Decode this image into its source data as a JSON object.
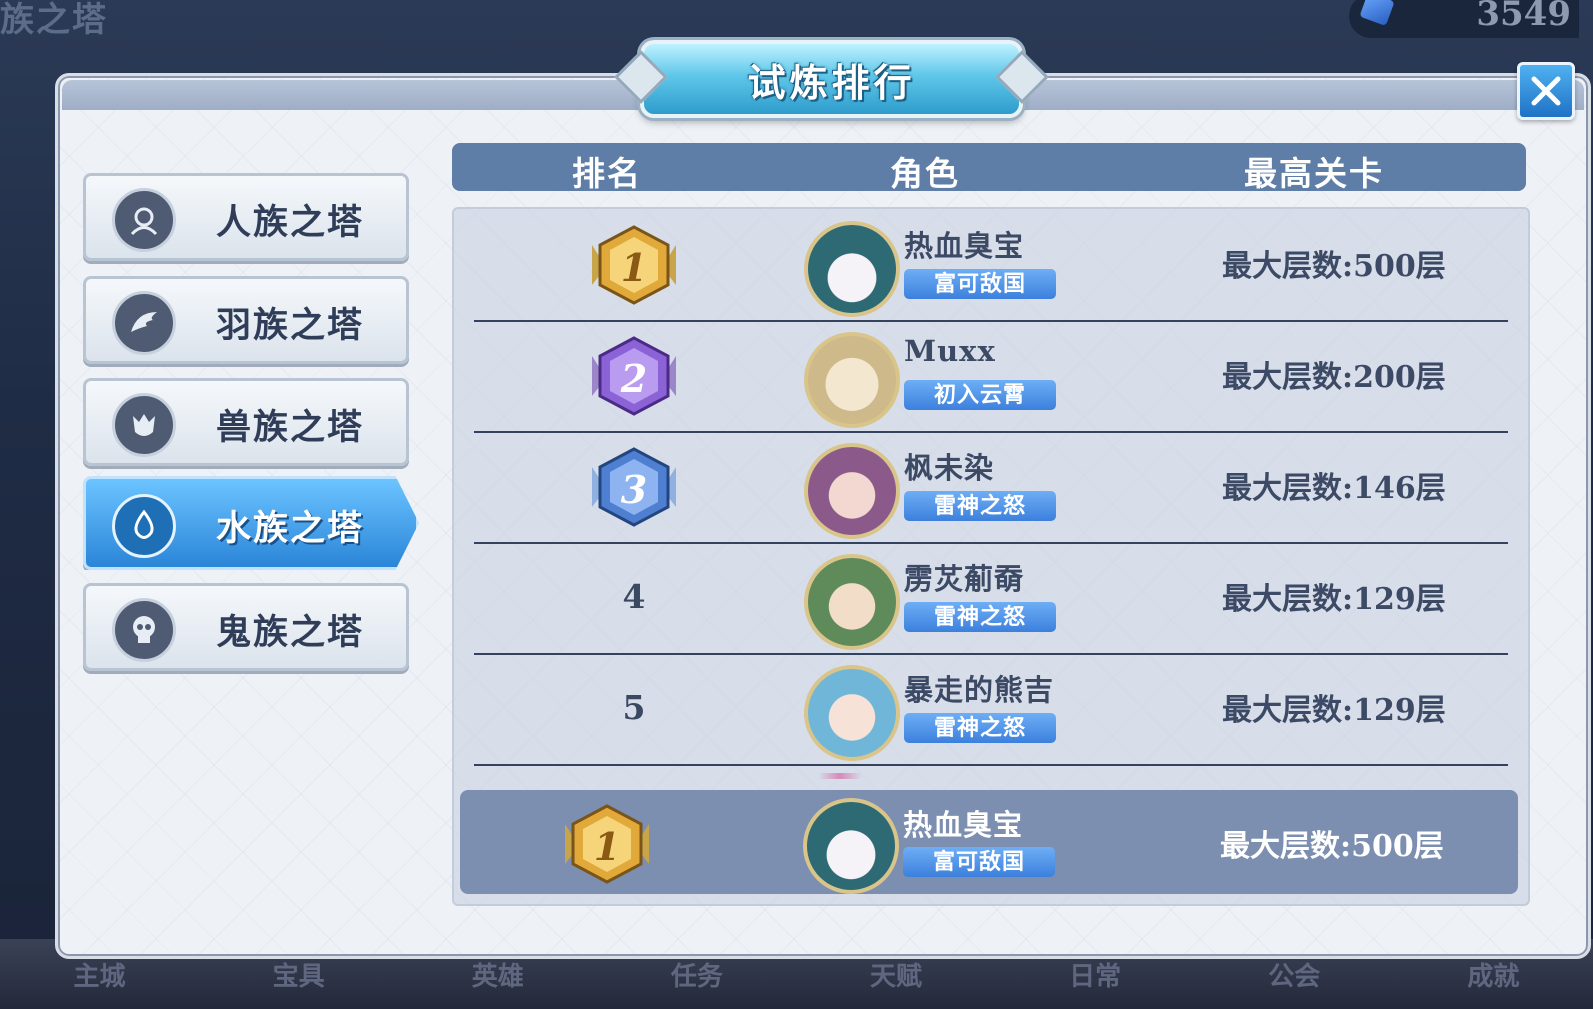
{
  "background": {
    "title": "族之塔",
    "currency_value": "3549",
    "nav_items": [
      "主城",
      "宝具",
      "英雄",
      "任务",
      "天赋",
      "日常",
      "公会",
      "成就"
    ]
  },
  "panel": {
    "title": "试炼排行"
  },
  "tabs": [
    {
      "label": "人族之塔",
      "icon": "human-emblem-icon",
      "active": false
    },
    {
      "label": "羽族之塔",
      "icon": "wing-emblem-icon",
      "active": false
    },
    {
      "label": "兽族之塔",
      "icon": "beast-emblem-icon",
      "active": false
    },
    {
      "label": "水族之塔",
      "icon": "water-emblem-icon",
      "active": true
    },
    {
      "label": "鬼族之塔",
      "icon": "skull-emblem-icon",
      "active": false
    }
  ],
  "table": {
    "headers": {
      "rank": "排名",
      "role": "角色",
      "max_stage": "最高关卡"
    },
    "rows": [
      {
        "rank": "1",
        "name": "热血臭宝",
        "title": "富可敌国",
        "max_floor": "最大层数:500层",
        "badge_color": "#e0a93a"
      },
      {
        "rank": "2",
        "name": "Muxx",
        "title": "初入云霄",
        "max_floor": "最大层数:200层",
        "badge_color": "#8c63d6"
      },
      {
        "rank": "3",
        "name": "枫未染",
        "title": "雷神之怒",
        "max_floor": "最大层数:146层",
        "badge_color": "#4f7fd0"
      },
      {
        "rank": "4",
        "name": "雳炗葪奣",
        "title": "雷神之怒",
        "max_floor": "最大层数:129层"
      },
      {
        "rank": "5",
        "name": "暴走的熊吉",
        "title": "雷神之怒",
        "max_floor": "最大层数:129层"
      }
    ],
    "my_rank": {
      "rank": "1",
      "name": "热血臭宝",
      "title": "富可敌国",
      "max_floor": "最大层数:500层",
      "badge_color": "#e0a93a"
    }
  },
  "colors": {
    "accent_blue": "#2a85d8",
    "header_bg": "#5e7da7",
    "title_chip": "#3c80dd",
    "my_row_bg": "#7c8fb0"
  }
}
